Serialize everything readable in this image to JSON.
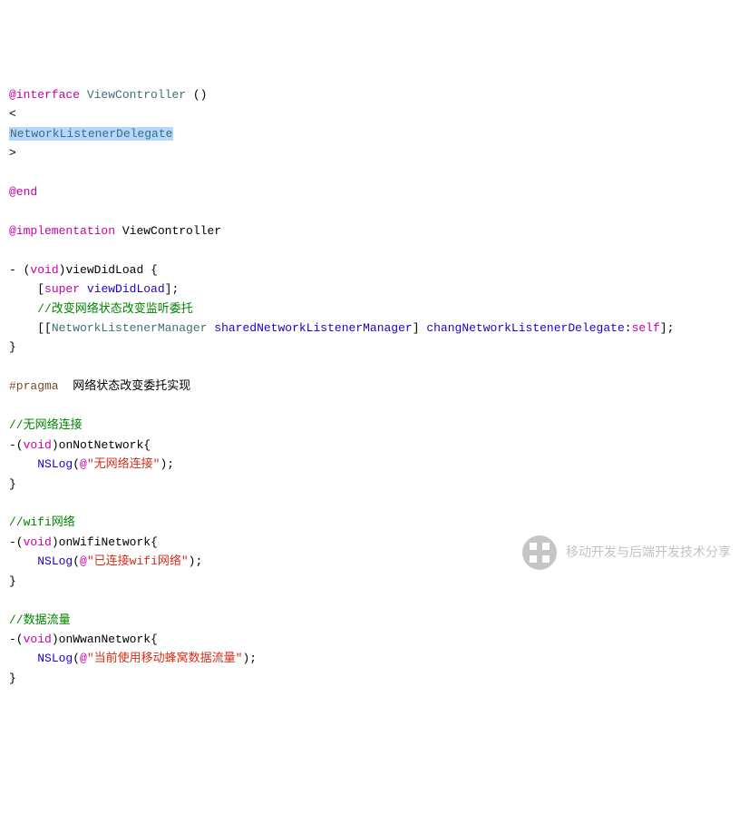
{
  "tokens": {
    "at_interface": "@interface",
    "viewcontroller": "ViewController",
    "parens": "()",
    "lt": "<",
    "network_listener_delegate": "NetworkListenerDelegate",
    "gt": ">",
    "at_end": "@end",
    "at_implementation": "@implementation",
    "dash": "- ",
    "lparen": "(",
    "void": "void",
    "rparen": ")",
    "viewDidLoad": "viewDidLoad",
    "space_lbrace": " {",
    "indent_bracket": "    [",
    "super": "super",
    "space": " ",
    "viewDidLoad2": "viewDidLoad",
    "bracket_semi": "];",
    "comment_change": "    //改变网络状态改变监听委托",
    "indent_dbracket": "    [[",
    "network_listener_manager": "NetworkListenerManager",
    "shared_manager": "sharedNetworkListenerManager",
    "rbracket_space": "] ",
    "chang_delegate": "changNetworkListenerDelegate",
    "colon": ":",
    "self": "self",
    "rbrace": "}",
    "pragma": "#pragma",
    "pragma_text": "  网络状态改变委托实现",
    "comment_no_network": "//无网络连接",
    "dash_noparen": "-(",
    "on_not_network": "onNotNetwork",
    "lbrace": "{",
    "indent": "    ",
    "nslog": "NSLog",
    "at": "@",
    "str_no_network": "\"无网络连接\"",
    "rparen_semi": ");",
    "comment_wifi": "//wifi网络",
    "on_wifi_network": "onWifiNetwork",
    "str_wifi": "\"已连接wifi网络\"",
    "comment_data": "//数据流量",
    "on_wwan_network": "onWwanNetwork",
    "str_wwan": "\"当前使用移动蜂窝数据流量\""
  },
  "watermark": "移动开发与后端开发技术分享"
}
